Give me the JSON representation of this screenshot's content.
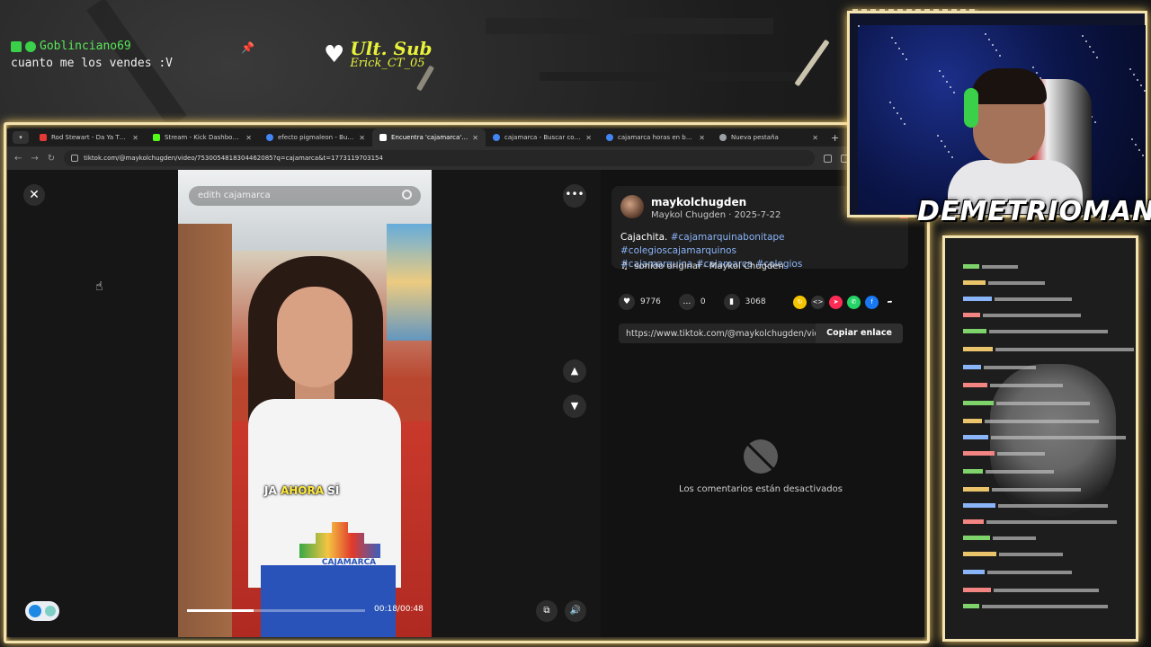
{
  "overlay": {
    "chat_user": "Goblinciano69",
    "chat_message": "cuanto me los vendes :V",
    "ult_sub_label": "Ult. Sub",
    "ult_sub_name": "Erick_CT_05",
    "streamer_name": "DEMETRIOMAN..."
  },
  "browser": {
    "tabs": [
      {
        "label": "Rod Stewart - Da Ya Think I",
        "favicon_color": "#e53935"
      },
      {
        "label": "Stream - Kick Dashboard",
        "favicon_color": "#53fc18"
      },
      {
        "label": "efecto pigmaleon - Buscar con",
        "favicon_color": "#4285f4"
      },
      {
        "label": "Encuentra 'cajamarca' en Ti",
        "favicon_color": "#ffffff",
        "active": true
      },
      {
        "label": "cajamarca - Buscar con Google",
        "favicon_color": "#4285f4"
      },
      {
        "label": "cajamarca horas en bus - Busc",
        "favicon_color": "#4285f4"
      },
      {
        "label": "Nueva pestaña",
        "favicon_color": "#9aa0a6"
      }
    ],
    "url": "tiktok.com/@maykolchugden/video/7530054818304462085?q=cajamarca&t=1773119703154"
  },
  "video": {
    "search_text": "edith cajamarca",
    "caption_pre": "JA ",
    "caption_hl": "AHORA",
    "caption_post": " SÍ",
    "shirt_text": "CAJAMARCA",
    "time": "00:18/00:48",
    "progress": 0.375
  },
  "post": {
    "username": "maykolchugden",
    "meta": "Maykol Chugden · 2025-7-22",
    "desc_prefix": "Cajachita. ",
    "hashtags_line1": "#cajamarquinabonitape #colegioscajamarquinos",
    "hashtags_line2": "#cajamarquina #cajamarca #colegios",
    "music": "sonido original - Maykol Chugden",
    "likes": "9776",
    "comments": "0",
    "saves": "3068",
    "link": "https://www.tiktok.com/@maykolchugden/video/7...",
    "copy_label": "Copiar enlace",
    "comments_disabled": "Los comentarios están desactivados"
  },
  "colors": {
    "frame_glow": "#ffd46a",
    "tiktok_red": "#fe2c55",
    "hashtag": "#8ab4f8"
  }
}
